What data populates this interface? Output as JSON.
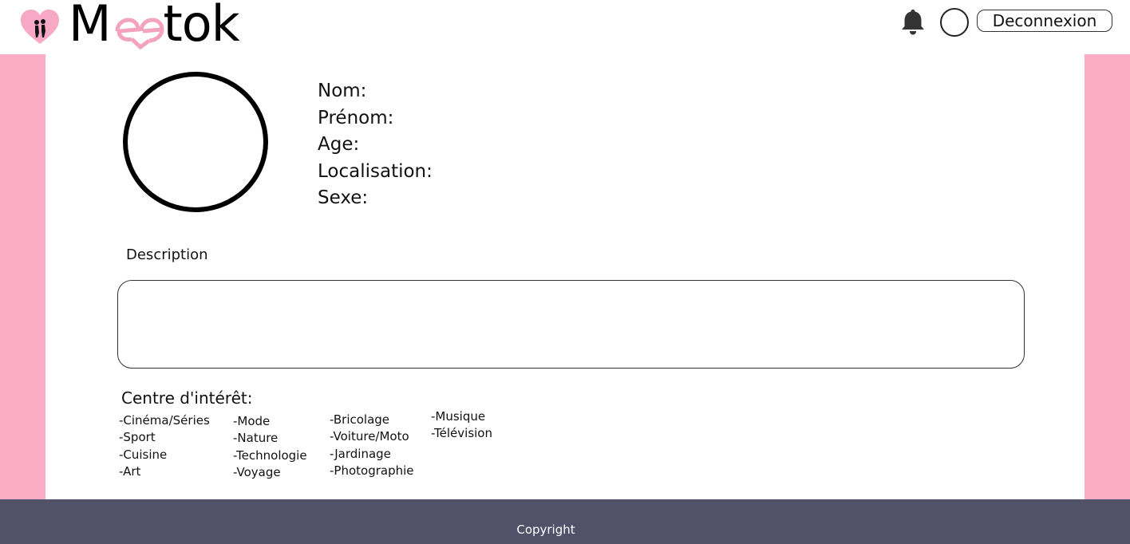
{
  "header": {
    "logo_left": "M",
    "logo_right": "tok",
    "logout_label": "Deconnexion"
  },
  "profile": {
    "fields": [
      "Nom:",
      "Prénom:",
      "Age:",
      "Localisation:",
      "Sexe:"
    ],
    "description_label": "Description",
    "description_value": ""
  },
  "interests": {
    "title": "Centre d'intérêt:",
    "columns": [
      [
        "-Cinéma/Séries",
        "-Sport",
        "-Cuisine",
        "-Art"
      ],
      [
        "-Mode",
        "-Nature",
        "-Technologie",
        "-Voyage"
      ],
      [
        "-Bricolage",
        "-Voiture/Moto",
        "-Jardinage",
        "-Photographie"
      ],
      [
        "-Musique",
        "-Télévision"
      ]
    ]
  },
  "footer": {
    "copyright": "Copyright"
  },
  "colors": {
    "pink": "#fbadc6",
    "footer": "#52516a"
  },
  "icons": [
    "heart-couple-icon",
    "bell-icon",
    "user-avatar-icon"
  ]
}
